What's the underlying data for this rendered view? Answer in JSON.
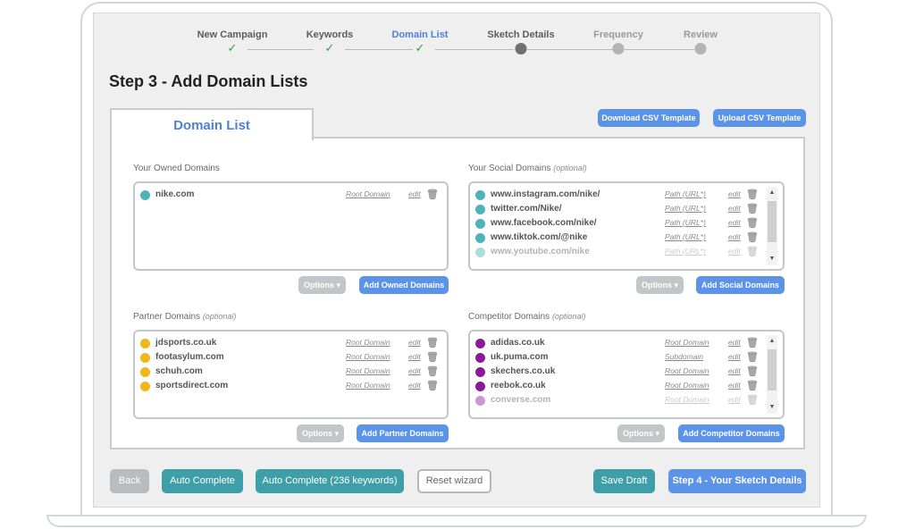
{
  "stepper": {
    "steps": [
      {
        "label": "New Campaign",
        "state": "done"
      },
      {
        "label": "Keywords",
        "state": "done"
      },
      {
        "label": "Domain List",
        "state": "active"
      },
      {
        "label": "Sketch Details",
        "state": "current"
      },
      {
        "label": "Frequency",
        "state": "future"
      },
      {
        "label": "Review",
        "state": "future"
      }
    ]
  },
  "page": {
    "title": "Step 3 - Add Domain Lists",
    "tab_label": "Domain List",
    "download_csv": "Download CSV Template",
    "upload_csv": "Upload CSV Template"
  },
  "owned": {
    "title": "Your Owned Domains",
    "optional": "",
    "domains": [
      {
        "domain": "nike.com",
        "type": "Root Domain",
        "color": "#4cb3b6"
      }
    ],
    "options_label": "Options",
    "add_label": "Add Owned Domains"
  },
  "social": {
    "title": "Your Social Domains",
    "optional": "(optional)",
    "domains": [
      {
        "domain": "www.instagram.com/nike/",
        "type": "Path (URL*)",
        "color": "#4cb3b6"
      },
      {
        "domain": "twitter.com/Nike/",
        "type": "Path (URL*)",
        "color": "#4cb3b6"
      },
      {
        "domain": "www.facebook.com/nike/",
        "type": "Path (URL*)",
        "color": "#4cb3b6"
      },
      {
        "domain": "www.tiktok.com/@nike",
        "type": "Path (URL*)",
        "color": "#4cb3b6"
      },
      {
        "domain": "www.youtube.com/nike",
        "type": "Path (URL*)",
        "color": "#4cb3b6"
      }
    ],
    "options_label": "Options",
    "add_label": "Add Social Domains"
  },
  "partner": {
    "title": "Partner Domains",
    "optional": "(optional)",
    "domains": [
      {
        "domain": "jdsports.co.uk",
        "type": "Root Domain",
        "color": "#f2b51d"
      },
      {
        "domain": "footasylum.com",
        "type": "Root Domain",
        "color": "#f2b51d"
      },
      {
        "domain": "schuh.com",
        "type": "Root Domain",
        "color": "#f2b51d"
      },
      {
        "domain": "sportsdirect.com",
        "type": "Root Domain",
        "color": "#f2b51d"
      }
    ],
    "options_label": "Options",
    "add_label": "Add Partner Domains"
  },
  "competitor": {
    "title": "Competitor Domains",
    "optional": "(optional)",
    "domains": [
      {
        "domain": "adidas.co.uk",
        "type": "Root Domain",
        "color": "#8a1a9a"
      },
      {
        "domain": "uk.puma.com",
        "type": "Subdomain",
        "color": "#8a1a9a"
      },
      {
        "domain": "skechers.co.uk",
        "type": "Root Domain",
        "color": "#8a1a9a"
      },
      {
        "domain": "reebok.co.uk",
        "type": "Root Domain",
        "color": "#8a1a9a"
      },
      {
        "domain": "converse.com",
        "type": "Root Domain",
        "color": "#8a1a9a"
      }
    ],
    "options_label": "Options",
    "add_label": "Add Competitor Domains"
  },
  "row_edit_label": "edit",
  "footer": {
    "back": "Back",
    "auto_complete": "Auto Complete",
    "auto_complete_keywords": "Auto Complete (236 keywords)",
    "reset": "Reset wizard",
    "save_draft": "Save Draft",
    "next": "Step 4 - Your Sketch Details"
  },
  "icons": {
    "check": "check-icon",
    "trash": "trash-icon",
    "caret": "caret-down-icon",
    "scroll_up": "scroll-up-icon",
    "scroll_down": "scroll-down-icon"
  }
}
